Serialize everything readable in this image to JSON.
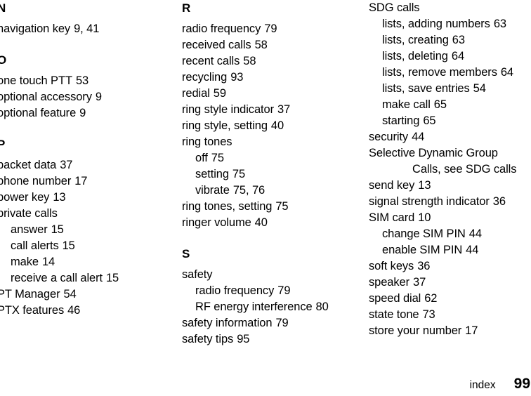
{
  "page": {
    "footer_label": "index",
    "page_number": "99"
  },
  "columns": [
    {
      "id": "column-1",
      "blocks": [
        {
          "letter": "N",
          "entries": [
            {
              "level": 0,
              "text": "navigation key",
              "pages": "9, 41"
            }
          ]
        },
        {
          "letter": "O",
          "entries": [
            {
              "level": 0,
              "text": "one touch PTT",
              "pages": "53"
            },
            {
              "level": 0,
              "text": "optional accessory",
              "pages": "9"
            },
            {
              "level": 0,
              "text": "optional feature",
              "pages": "9"
            }
          ]
        },
        {
          "letter": "P",
          "entries": [
            {
              "level": 0,
              "text": "packet data",
              "pages": "37"
            },
            {
              "level": 0,
              "text": "phone number",
              "pages": "17"
            },
            {
              "level": 0,
              "text": "power key",
              "pages": "13"
            },
            {
              "level": 0,
              "text": "private calls",
              "pages": ""
            },
            {
              "level": 1,
              "text": "answer",
              "pages": "15"
            },
            {
              "level": 1,
              "text": "call alerts",
              "pages": "15"
            },
            {
              "level": 1,
              "text": "make",
              "pages": "14"
            },
            {
              "level": 1,
              "text": "receive a call alert",
              "pages": "15"
            },
            {
              "level": 0,
              "text": "PT Manager",
              "pages": "54"
            },
            {
              "level": 0,
              "text": "PTX features",
              "pages": "46"
            }
          ]
        }
      ]
    },
    {
      "id": "column-2",
      "blocks": [
        {
          "letter": "R",
          "entries": [
            {
              "level": 0,
              "text": "radio frequency",
              "pages": "79"
            },
            {
              "level": 0,
              "text": "received calls",
              "pages": "58"
            },
            {
              "level": 0,
              "text": "recent calls",
              "pages": "58"
            },
            {
              "level": 0,
              "text": "recycling",
              "pages": "93"
            },
            {
              "level": 0,
              "text": "redial",
              "pages": "59"
            },
            {
              "level": 0,
              "text": "ring style indicator",
              "pages": "37"
            },
            {
              "level": 0,
              "text": "ring style, setting",
              "pages": "40"
            },
            {
              "level": 0,
              "text": "ring tones",
              "pages": ""
            },
            {
              "level": 1,
              "text": "off",
              "pages": "75"
            },
            {
              "level": 1,
              "text": "setting",
              "pages": "75"
            },
            {
              "level": 1,
              "text": "vibrate",
              "pages": "75, 76"
            },
            {
              "level": 0,
              "text": "ring tones, setting",
              "pages": "75"
            },
            {
              "level": 0,
              "text": "ringer volume",
              "pages": "40"
            }
          ]
        },
        {
          "letter": "S",
          "entries": [
            {
              "level": 0,
              "text": "safety",
              "pages": ""
            },
            {
              "level": 1,
              "text": "radio frequency",
              "pages": "79"
            },
            {
              "level": 1,
              "text": "RF energy interference",
              "pages": "80"
            },
            {
              "level": 0,
              "text": "safety information",
              "pages": "79"
            },
            {
              "level": 0,
              "text": "safety tips",
              "pages": "95"
            }
          ]
        }
      ]
    },
    {
      "id": "column-3",
      "blocks": [
        {
          "letter": "",
          "entries": [
            {
              "level": 0,
              "text": "SDG calls",
              "pages": ""
            },
            {
              "level": 1,
              "text": "lists, adding numbers",
              "pages": "63"
            },
            {
              "level": 1,
              "text": "lists, creating",
              "pages": "63"
            },
            {
              "level": 1,
              "text": "lists, deleting",
              "pages": "64"
            },
            {
              "level": 1,
              "text": "lists, remove members",
              "pages": "64"
            },
            {
              "level": 1,
              "text": "lists, save entries",
              "pages": "54"
            },
            {
              "level": 1,
              "text": "make call",
              "pages": "65"
            },
            {
              "level": 1,
              "text": "starting",
              "pages": "65"
            },
            {
              "level": 0,
              "text": "security",
              "pages": "44"
            },
            {
              "level": 0,
              "text": "Selective Dynamic Group",
              "pages": ""
            },
            {
              "level": 2,
              "text": "Calls, see SDG calls",
              "pages": ""
            },
            {
              "level": 0,
              "text": "send key",
              "pages": "13"
            },
            {
              "level": 0,
              "text": "signal strength indicator",
              "pages": "36"
            },
            {
              "level": 0,
              "text": "SIM card",
              "pages": "10"
            },
            {
              "level": 1,
              "text": "change SIM PIN",
              "pages": "44"
            },
            {
              "level": 1,
              "text": "enable SIM PIN",
              "pages": "44"
            },
            {
              "level": 0,
              "text": "soft keys",
              "pages": "36"
            },
            {
              "level": 0,
              "text": "speaker",
              "pages": "37"
            },
            {
              "level": 0,
              "text": "speed dial",
              "pages": "62"
            },
            {
              "level": 0,
              "text": "state tone",
              "pages": "73"
            },
            {
              "level": 0,
              "text": "store your number",
              "pages": "17"
            }
          ]
        }
      ]
    }
  ]
}
